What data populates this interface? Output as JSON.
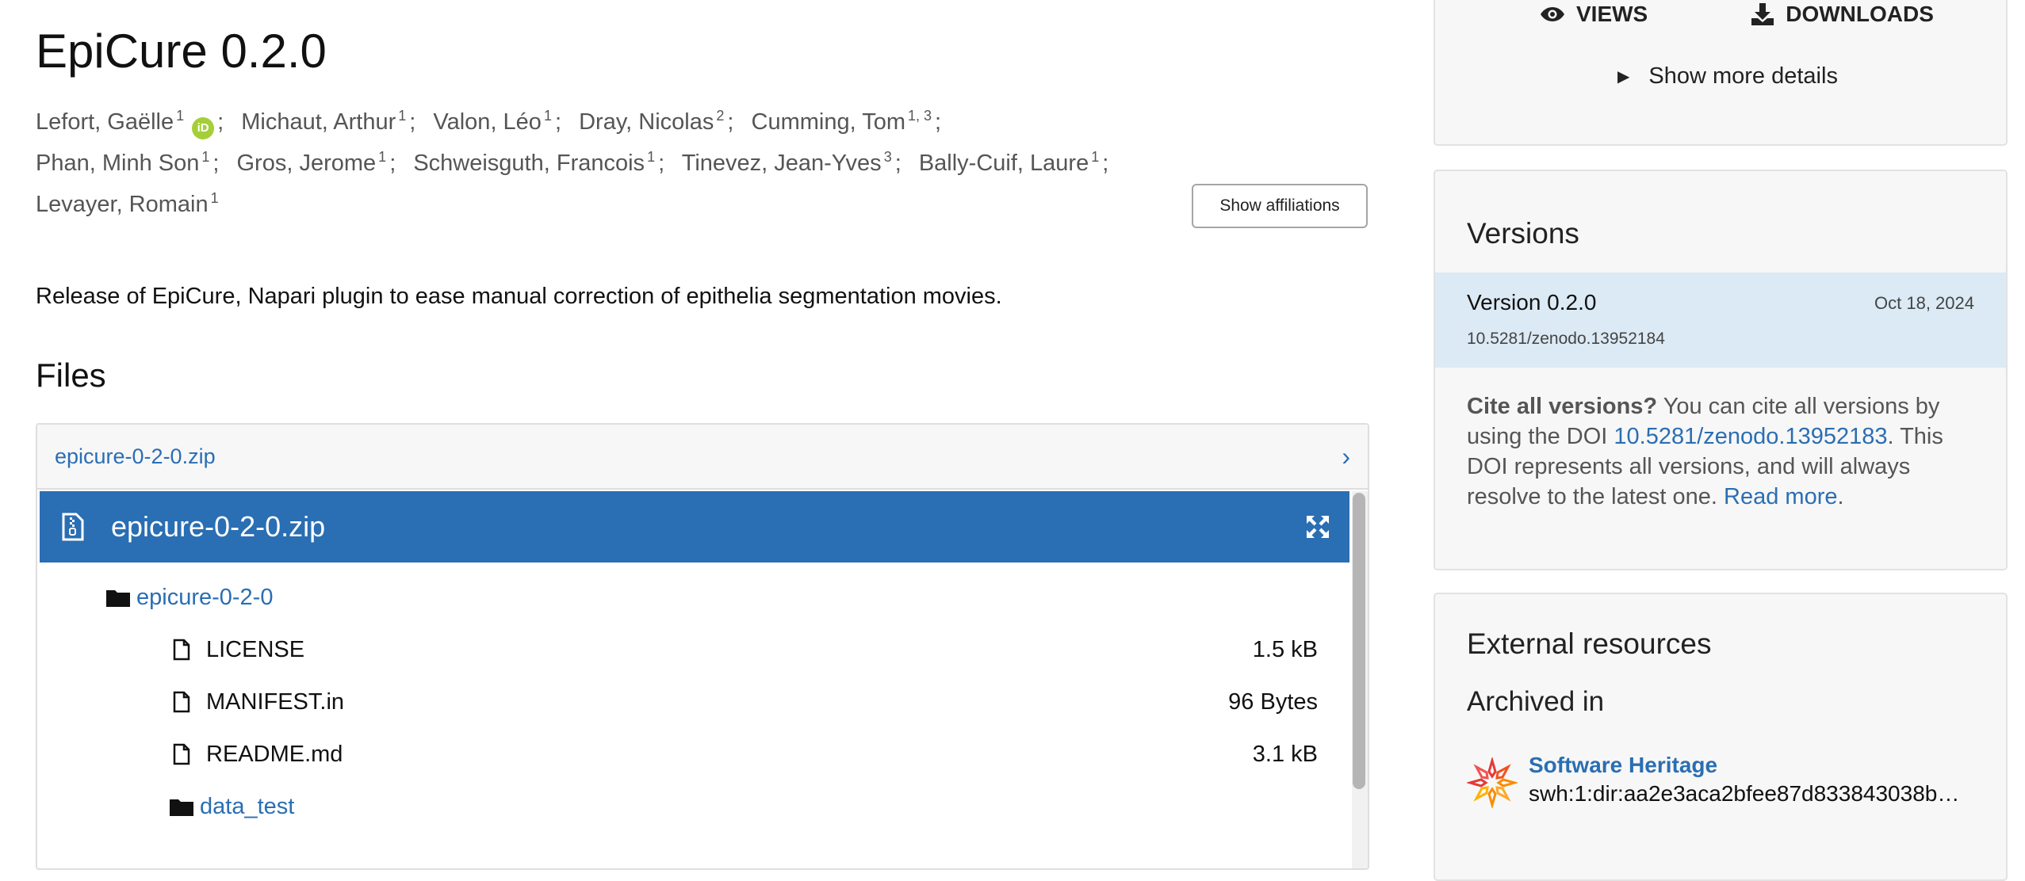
{
  "record": {
    "title": "EpiCure 0.2.0",
    "authors": [
      {
        "name": "Lefort, Gaëlle",
        "aff": "1",
        "orcid": true
      },
      {
        "name": "Michaut, Arthur",
        "aff": "1"
      },
      {
        "name": "Valon, Léo",
        "aff": "1"
      },
      {
        "name": "Dray, Nicolas",
        "aff": "2"
      },
      {
        "name": "Cumming, Tom",
        "aff": "1, 3"
      },
      {
        "name": "Phan, Minh Son",
        "aff": "1"
      },
      {
        "name": "Gros, Jerome",
        "aff": "1"
      },
      {
        "name": "Schweisguth, Francois",
        "aff": "1"
      },
      {
        "name": "Tinevez, Jean-Yves",
        "aff": "3"
      },
      {
        "name": "Bally-Cuif, Laure",
        "aff": "1"
      },
      {
        "name": "Levayer, Romain",
        "aff": "1"
      }
    ],
    "show_affiliations_label": "Show affiliations",
    "description": "Release of EpiCure, Napari plugin to ease manual correction of epithelia segmentation movies."
  },
  "files": {
    "heading": "Files",
    "archive_name": "epicure-0-2-0.zip",
    "preview_title": "epicure-0-2-0.zip",
    "tree": [
      {
        "label": "epicure-0-2-0",
        "type": "folder",
        "size": ""
      },
      {
        "label": "LICENSE",
        "type": "file",
        "size": "1.5 kB"
      },
      {
        "label": "MANIFEST.in",
        "type": "file",
        "size": "96 Bytes"
      },
      {
        "label": "README.md",
        "type": "file",
        "size": "3.1 kB"
      },
      {
        "label": "data_test",
        "type": "folder",
        "size": ""
      }
    ]
  },
  "stats": {
    "views_label": "VIEWS",
    "downloads_label": "DOWNLOADS",
    "show_more_label": "Show more details"
  },
  "versions": {
    "heading": "Versions",
    "active_version": "Version 0.2.0",
    "active_date": "Oct 18, 2024",
    "active_doi": "10.5281/zenodo.13952184",
    "cite_bold": "Cite all versions?",
    "cite_text1": " You can cite all versions by using the DOI ",
    "concept_doi": "10.5281/zenodo.13952183",
    "cite_text2": ". This DOI represents all versions, and will always resolve to the latest one. ",
    "read_more": "Read more",
    "period": "."
  },
  "external": {
    "heading": "External resources",
    "archived_in": "Archived in",
    "swh_name": "Software Heritage",
    "swh_id": "swh:1:dir:aa2e3aca2bfee87d833843038b…"
  },
  "colors": {
    "link": "#2a6eb3",
    "preview_bar": "#2a6eb3",
    "active_version_bg": "#dbeaf4",
    "orcid": "#a6ce39"
  }
}
